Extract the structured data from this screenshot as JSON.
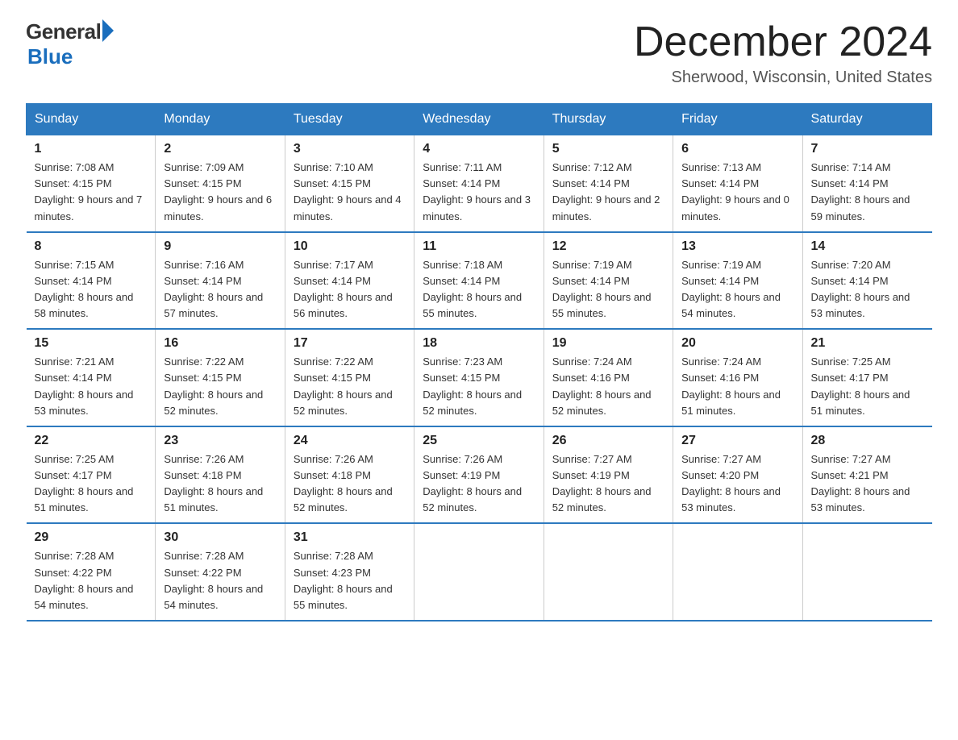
{
  "logo": {
    "general": "General",
    "blue": "Blue"
  },
  "title": "December 2024",
  "location": "Sherwood, Wisconsin, United States",
  "days_of_week": [
    "Sunday",
    "Monday",
    "Tuesday",
    "Wednesday",
    "Thursday",
    "Friday",
    "Saturday"
  ],
  "weeks": [
    [
      {
        "day": "1",
        "sunrise": "7:08 AM",
        "sunset": "4:15 PM",
        "daylight": "9 hours and 7 minutes."
      },
      {
        "day": "2",
        "sunrise": "7:09 AM",
        "sunset": "4:15 PM",
        "daylight": "9 hours and 6 minutes."
      },
      {
        "day": "3",
        "sunrise": "7:10 AM",
        "sunset": "4:15 PM",
        "daylight": "9 hours and 4 minutes."
      },
      {
        "day": "4",
        "sunrise": "7:11 AM",
        "sunset": "4:14 PM",
        "daylight": "9 hours and 3 minutes."
      },
      {
        "day": "5",
        "sunrise": "7:12 AM",
        "sunset": "4:14 PM",
        "daylight": "9 hours and 2 minutes."
      },
      {
        "day": "6",
        "sunrise": "7:13 AM",
        "sunset": "4:14 PM",
        "daylight": "9 hours and 0 minutes."
      },
      {
        "day": "7",
        "sunrise": "7:14 AM",
        "sunset": "4:14 PM",
        "daylight": "8 hours and 59 minutes."
      }
    ],
    [
      {
        "day": "8",
        "sunrise": "7:15 AM",
        "sunset": "4:14 PM",
        "daylight": "8 hours and 58 minutes."
      },
      {
        "day": "9",
        "sunrise": "7:16 AM",
        "sunset": "4:14 PM",
        "daylight": "8 hours and 57 minutes."
      },
      {
        "day": "10",
        "sunrise": "7:17 AM",
        "sunset": "4:14 PM",
        "daylight": "8 hours and 56 minutes."
      },
      {
        "day": "11",
        "sunrise": "7:18 AM",
        "sunset": "4:14 PM",
        "daylight": "8 hours and 55 minutes."
      },
      {
        "day": "12",
        "sunrise": "7:19 AM",
        "sunset": "4:14 PM",
        "daylight": "8 hours and 55 minutes."
      },
      {
        "day": "13",
        "sunrise": "7:19 AM",
        "sunset": "4:14 PM",
        "daylight": "8 hours and 54 minutes."
      },
      {
        "day": "14",
        "sunrise": "7:20 AM",
        "sunset": "4:14 PM",
        "daylight": "8 hours and 53 minutes."
      }
    ],
    [
      {
        "day": "15",
        "sunrise": "7:21 AM",
        "sunset": "4:14 PM",
        "daylight": "8 hours and 53 minutes."
      },
      {
        "day": "16",
        "sunrise": "7:22 AM",
        "sunset": "4:15 PM",
        "daylight": "8 hours and 52 minutes."
      },
      {
        "day": "17",
        "sunrise": "7:22 AM",
        "sunset": "4:15 PM",
        "daylight": "8 hours and 52 minutes."
      },
      {
        "day": "18",
        "sunrise": "7:23 AM",
        "sunset": "4:15 PM",
        "daylight": "8 hours and 52 minutes."
      },
      {
        "day": "19",
        "sunrise": "7:24 AM",
        "sunset": "4:16 PM",
        "daylight": "8 hours and 52 minutes."
      },
      {
        "day": "20",
        "sunrise": "7:24 AM",
        "sunset": "4:16 PM",
        "daylight": "8 hours and 51 minutes."
      },
      {
        "day": "21",
        "sunrise": "7:25 AM",
        "sunset": "4:17 PM",
        "daylight": "8 hours and 51 minutes."
      }
    ],
    [
      {
        "day": "22",
        "sunrise": "7:25 AM",
        "sunset": "4:17 PM",
        "daylight": "8 hours and 51 minutes."
      },
      {
        "day": "23",
        "sunrise": "7:26 AM",
        "sunset": "4:18 PM",
        "daylight": "8 hours and 51 minutes."
      },
      {
        "day": "24",
        "sunrise": "7:26 AM",
        "sunset": "4:18 PM",
        "daylight": "8 hours and 52 minutes."
      },
      {
        "day": "25",
        "sunrise": "7:26 AM",
        "sunset": "4:19 PM",
        "daylight": "8 hours and 52 minutes."
      },
      {
        "day": "26",
        "sunrise": "7:27 AM",
        "sunset": "4:19 PM",
        "daylight": "8 hours and 52 minutes."
      },
      {
        "day": "27",
        "sunrise": "7:27 AM",
        "sunset": "4:20 PM",
        "daylight": "8 hours and 53 minutes."
      },
      {
        "day": "28",
        "sunrise": "7:27 AM",
        "sunset": "4:21 PM",
        "daylight": "8 hours and 53 minutes."
      }
    ],
    [
      {
        "day": "29",
        "sunrise": "7:28 AM",
        "sunset": "4:22 PM",
        "daylight": "8 hours and 54 minutes."
      },
      {
        "day": "30",
        "sunrise": "7:28 AM",
        "sunset": "4:22 PM",
        "daylight": "8 hours and 54 minutes."
      },
      {
        "day": "31",
        "sunrise": "7:28 AM",
        "sunset": "4:23 PM",
        "daylight": "8 hours and 55 minutes."
      },
      null,
      null,
      null,
      null
    ]
  ],
  "labels": {
    "sunrise": "Sunrise:",
    "sunset": "Sunset:",
    "daylight": "Daylight:"
  }
}
